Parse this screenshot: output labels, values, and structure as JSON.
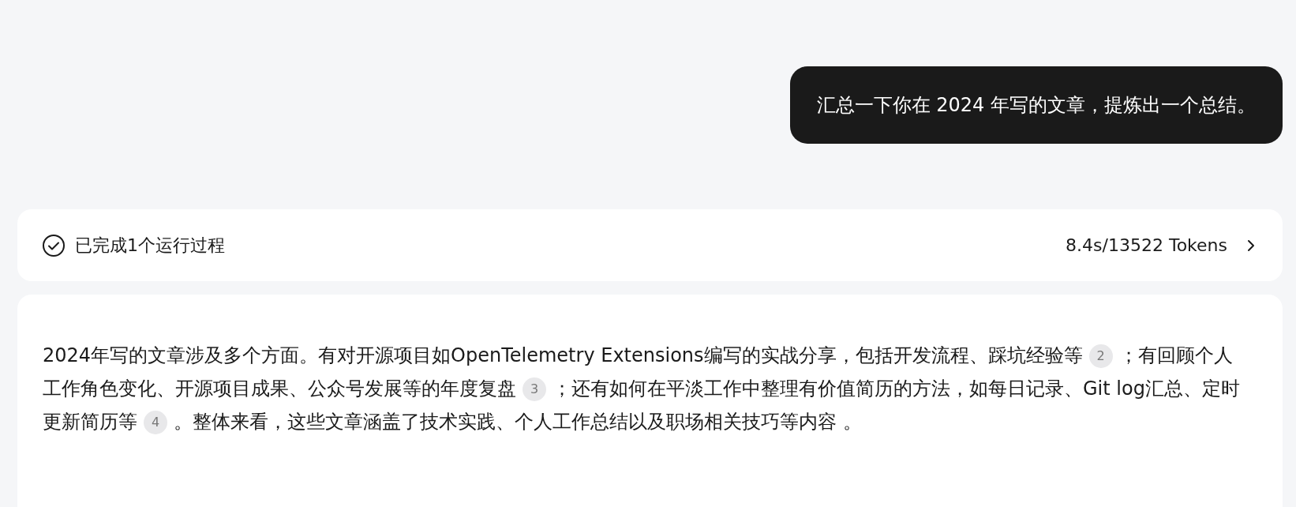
{
  "user_message": {
    "text": "汇总一下你在 2024 年写的文章，提炼出一个总结。"
  },
  "process": {
    "status": "已完成1个运行过程",
    "stats": "8.4s/13522 Tokens",
    "done": true
  },
  "answer": {
    "segments": [
      {
        "kind": "text",
        "text": "2024年写的文章涉及多个方面。有对开源项目如OpenTelemetry Extensions编写的实战分享，包括开发流程、踩坑经验等"
      },
      {
        "kind": "citation",
        "text": "2"
      },
      {
        "kind": "text",
        "text": "；有回顾个人工作角色变化、开源项目成果、公众号发展等的年度复盘"
      },
      {
        "kind": "citation",
        "text": "3"
      },
      {
        "kind": "text",
        "text": "；还有如何在平淡工作中整理有价值简历的方法，如每日记录、Git log汇总、定时更新简历等"
      },
      {
        "kind": "citation",
        "text": "4"
      },
      {
        "kind": "text",
        "text": "。整体来看，这些文章涵盖了技术实践、个人工作总结以及职场相关技巧等内容 。"
      }
    ]
  }
}
